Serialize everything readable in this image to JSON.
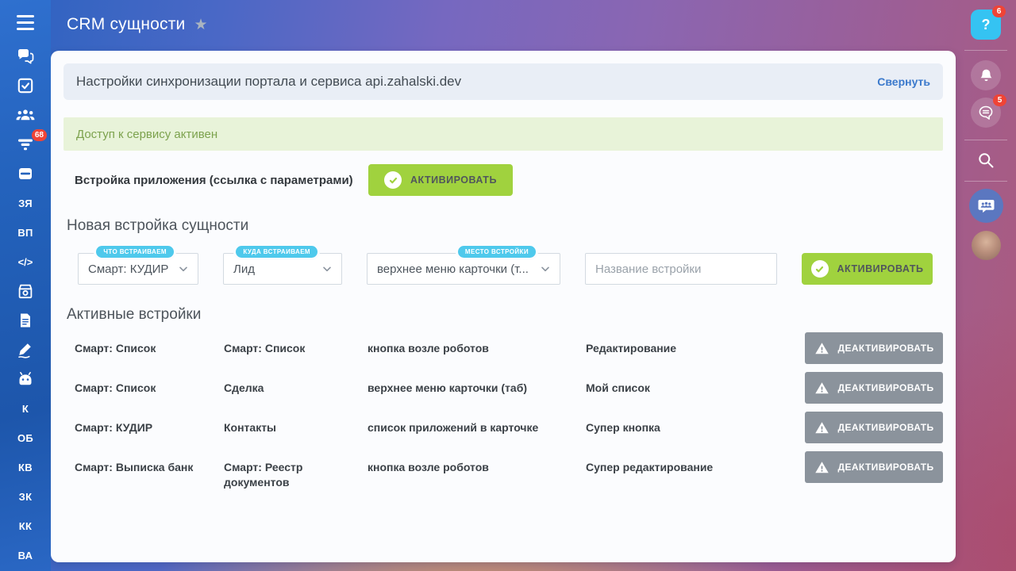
{
  "app": {
    "title": "CRM сущности"
  },
  "left_sidebar": {
    "crm_badge": "68",
    "code_label": "</>",
    "text_shortcuts": [
      "ЗЯ",
      "ВП",
      "К",
      "ОБ",
      "КВ",
      "ЗК",
      "КК",
      "ВА"
    ]
  },
  "right_rail": {
    "help_label": "?",
    "help_badge": "6",
    "messages_badge": "5"
  },
  "panel": {
    "sync_header": {
      "title": "Настройки синхронизации портала и сервиса api.zahalski.dev",
      "collapse_label": "Свернуть"
    },
    "status_banner": {
      "text": "Доступ к сервису активен"
    },
    "app_embed": {
      "label": "Встройка приложения (ссылка с параметрами)",
      "activate_label": "АКТИВИРОВАТЬ"
    },
    "new_embed": {
      "title": "Новая встройка сущности",
      "entity_select": {
        "badge": "ЧТО ВСТРАИВАЕМ",
        "value": "Смарт: КУДИР"
      },
      "target_select": {
        "badge": "КУДА ВСТРАИВАЕМ",
        "value": "Лид"
      },
      "place_select": {
        "badge": "МЕСТО ВСТРОЙКИ",
        "value": "верхнее меню карточки (т..."
      },
      "name_input": {
        "placeholder": "Название встройки"
      },
      "activate_label": "АКТИВИРОВАТЬ"
    },
    "active_embeds": {
      "title": "Активные встройки",
      "deactivate_label": "ДЕАКТИВИРОВАТЬ",
      "rows": [
        {
          "entity": "Смарт: Список",
          "target": "Смарт: Список",
          "place": "кнопка возле роботов",
          "name": "Редактирование"
        },
        {
          "entity": "Смарт: Список",
          "target": "Сделка",
          "place": "верхнее меню карточки (таб)",
          "name": "Мой список"
        },
        {
          "entity": "Смарт: КУДИР",
          "target": "Контакты",
          "place": "список приложений в карточке",
          "name": "Супер кнопка"
        },
        {
          "entity": "Смарт: Выписка банк",
          "target": "Смарт: Реестр документов",
          "place": "кнопка возле роботов",
          "name": "Супер редактирование"
        }
      ]
    }
  },
  "colors": {
    "accent_lime": "#a0d23e",
    "badge_blue": "#4ec9ec",
    "deactivate_gray": "#8b939c",
    "banner_green_bg": "#e8f3d9",
    "banner_green_text": "#7ca24d",
    "link_blue": "#3b79cc",
    "alert_red": "#ef4436",
    "sidebar_blue": "#2463bd"
  }
}
